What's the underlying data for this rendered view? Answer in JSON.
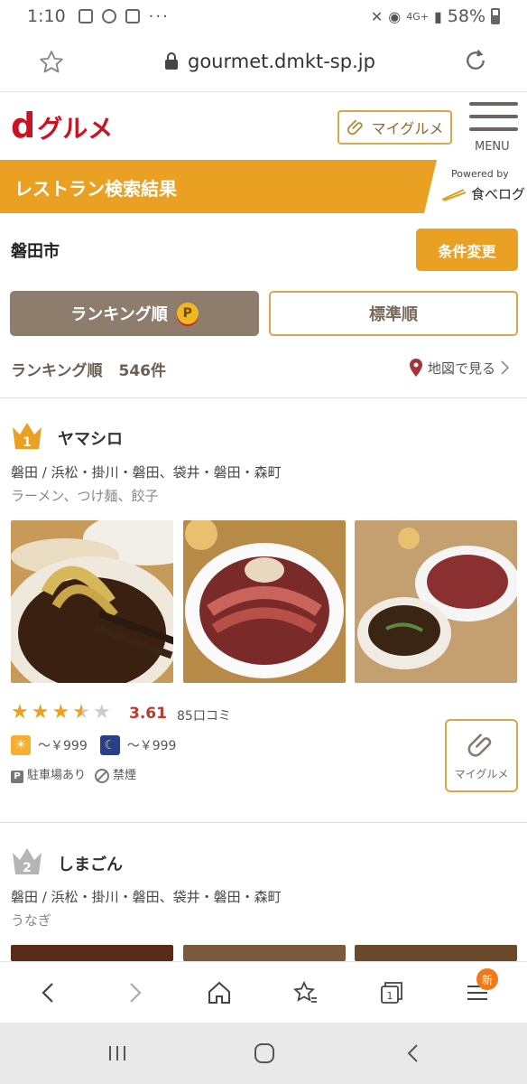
{
  "status_bar": {
    "time": "1:10",
    "extra": "···",
    "signal": "4G+",
    "battery": "58%"
  },
  "browser": {
    "url": "gourmet.dmkt-sp.jp"
  },
  "site_header": {
    "logo_prefix": "d",
    "logo_text": "グルメ",
    "my_gourmet_label": "マイグルメ",
    "menu_label": "MENU"
  },
  "band": {
    "title": "レストラン検索結果",
    "powered_by": "Powered by",
    "tabelog": "食べログ"
  },
  "search": {
    "city": "磐田市",
    "change_button": "条件変更"
  },
  "sort": {
    "ranking_label": "ランキング順",
    "ranking_badge": "P",
    "standard_label": "標準順"
  },
  "results": {
    "sort_label": "ランキング順",
    "count": "546件",
    "map_link": "地図で見る"
  },
  "restaurants": [
    {
      "rank": "1",
      "name": "ヤマシロ",
      "area": "磐田 / 浜松・掛川・磐田、袋井・磐田・森町",
      "genre": "ラーメン、つけ麺、餃子",
      "rating": 3.61,
      "rating_text": "3.61",
      "reviews": "85口コミ",
      "lunch_price": "～￥999",
      "dinner_price": "～￥999",
      "tags": [
        "駐車場あり",
        "禁煙"
      ],
      "my_label": "マイグルメ"
    },
    {
      "rank": "2",
      "name": "しまごん",
      "area": "磐田 / 浜松・掛川・磐田、袋井・磐田・森町",
      "genre": "うなぎ"
    }
  ],
  "colors": {
    "accent": "#e9a023",
    "brand_red": "#cc1122",
    "sort_active": "#8e7c6d"
  }
}
